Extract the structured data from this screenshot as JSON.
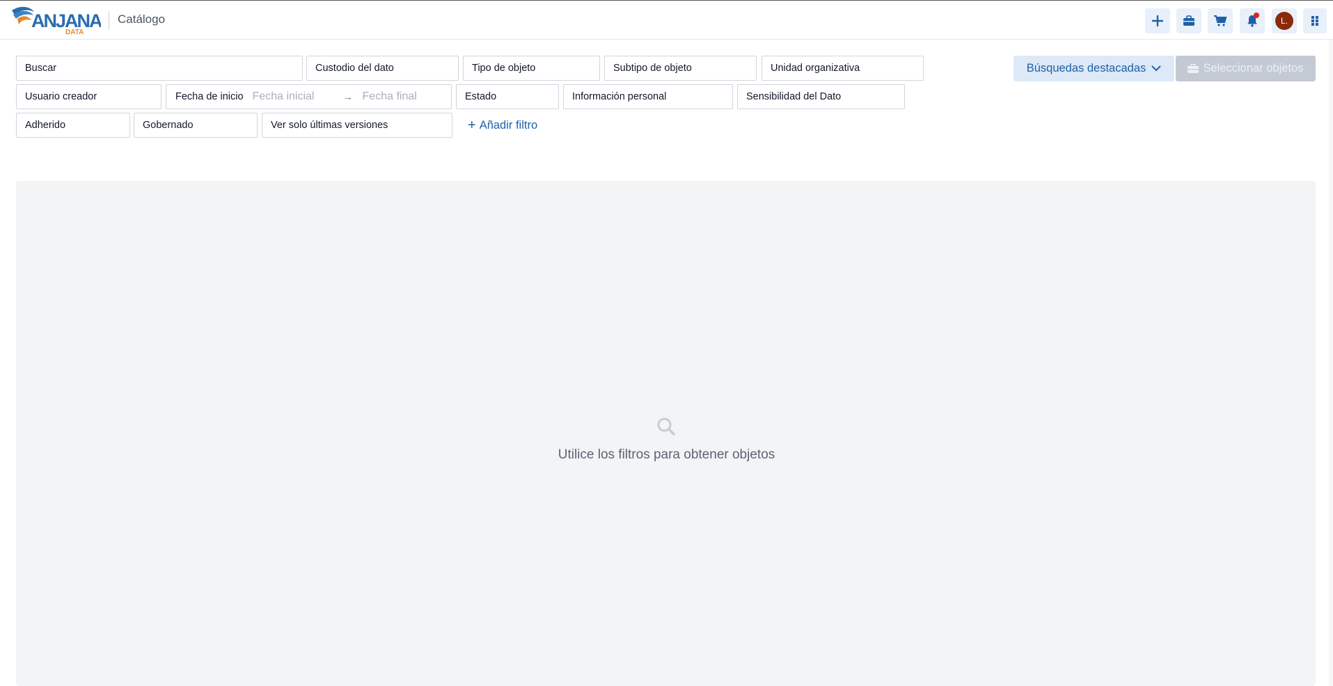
{
  "header": {
    "logo_text": "ANJANA DATA",
    "page_title": "Catálogo",
    "user_initial": "L.",
    "icons": [
      "plus-icon",
      "briefcase-icon",
      "cart-icon",
      "bell-icon",
      "avatar",
      "apps-grid-icon"
    ]
  },
  "filters": {
    "row1": [
      "Buscar",
      "Custodio del dato",
      "Tipo de objeto",
      "Subtipo de objeto",
      "Unidad organizativa"
    ],
    "row2": {
      "usuario_creador": "Usuario creador",
      "fecha_label": "Fecha de inicio",
      "fecha_inicial_placeholder": "Fecha inicial",
      "fecha_arrow": "→",
      "fecha_final_placeholder": "Fecha final",
      "estado": "Estado",
      "informacion_personal": "Información personal",
      "sensibilidad": "Sensibilidad del Dato"
    },
    "row3": [
      "Adherido",
      "Gobernado",
      "Ver solo últimas versiones"
    ],
    "add_filter_label": "Añadir filtro"
  },
  "actions": {
    "busquedas_destacadas": "Búsquedas destacadas",
    "seleccionar_objetos": "Seleccionar objetos"
  },
  "results": {
    "empty_message": "Utilice los filtros para obtener objetos"
  },
  "colors": {
    "accent": "#1f5fa8",
    "button_bg": "#e8f0fa",
    "disabled_bg": "#c3cad3",
    "panel_bg": "#f3f4f6",
    "avatar_bg": "#8a2a0a",
    "notification": "#e02020"
  }
}
